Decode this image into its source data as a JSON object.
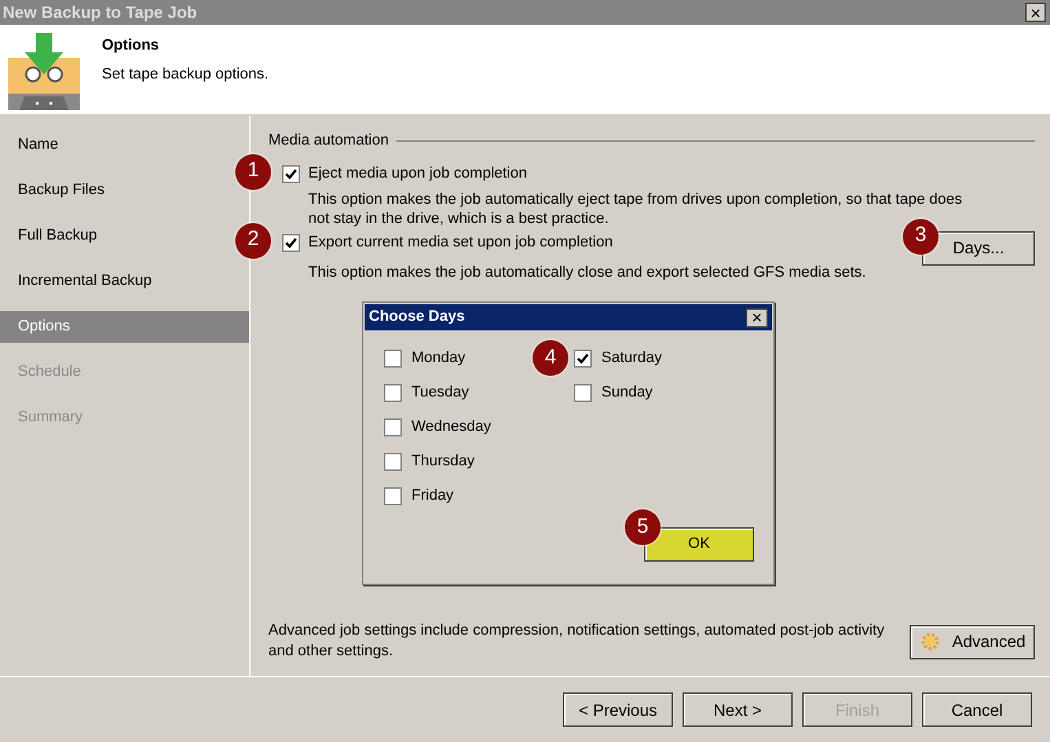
{
  "window": {
    "title": "New Backup to Tape Job",
    "close": "×"
  },
  "header": {
    "title": "Options",
    "subtitle": "Set tape backup options."
  },
  "sidebar": {
    "items": [
      {
        "label": "Name",
        "selected": false,
        "disabled": false
      },
      {
        "label": "Backup Files",
        "selected": false,
        "disabled": false
      },
      {
        "label": "Full Backup",
        "selected": false,
        "disabled": false
      },
      {
        "label": "Incremental Backup",
        "selected": false,
        "disabled": false
      },
      {
        "label": "Options",
        "selected": true,
        "disabled": false
      },
      {
        "label": "Schedule",
        "selected": false,
        "disabled": true
      },
      {
        "label": "Summary",
        "selected": false,
        "disabled": true
      }
    ]
  },
  "media_automation": {
    "title": "Media automation",
    "options": [
      {
        "label": "Eject media upon job completion",
        "checked": true,
        "callout": "1",
        "description": "This option makes the job automatically eject tape from drives upon completion, so that tape does not stay in the drive, which is a best practice."
      },
      {
        "label": "Export current media set upon job completion",
        "checked": true,
        "callout": "2",
        "description": "This option makes the job automatically close and export selected GFS media sets.",
        "button": {
          "label": "Days...",
          "callout": "3"
        }
      }
    ]
  },
  "advanced": {
    "text": "Advanced job settings include compression, notification settings, automated post-job activity and other settings.",
    "button": "Advanced"
  },
  "footer": {
    "buttons": [
      {
        "label": "< Previous",
        "disabled": false
      },
      {
        "label": "Next >",
        "disabled": false
      },
      {
        "label": "Finish",
        "disabled": true
      },
      {
        "label": "Cancel",
        "disabled": false
      }
    ]
  },
  "dialog": {
    "title": "Choose Days",
    "close": "×",
    "columns": [
      [
        {
          "label": "Monday",
          "checked": false
        },
        {
          "label": "Tuesday",
          "checked": false
        },
        {
          "label": "Wednesday",
          "checked": false
        },
        {
          "label": "Thursday",
          "checked": false
        },
        {
          "label": "Friday",
          "checked": false
        }
      ],
      [
        {
          "label": "Saturday",
          "checked": true,
          "callout": "4"
        },
        {
          "label": "Sunday",
          "checked": false
        }
      ]
    ],
    "ok": {
      "label": "OK",
      "callout": "5"
    }
  }
}
